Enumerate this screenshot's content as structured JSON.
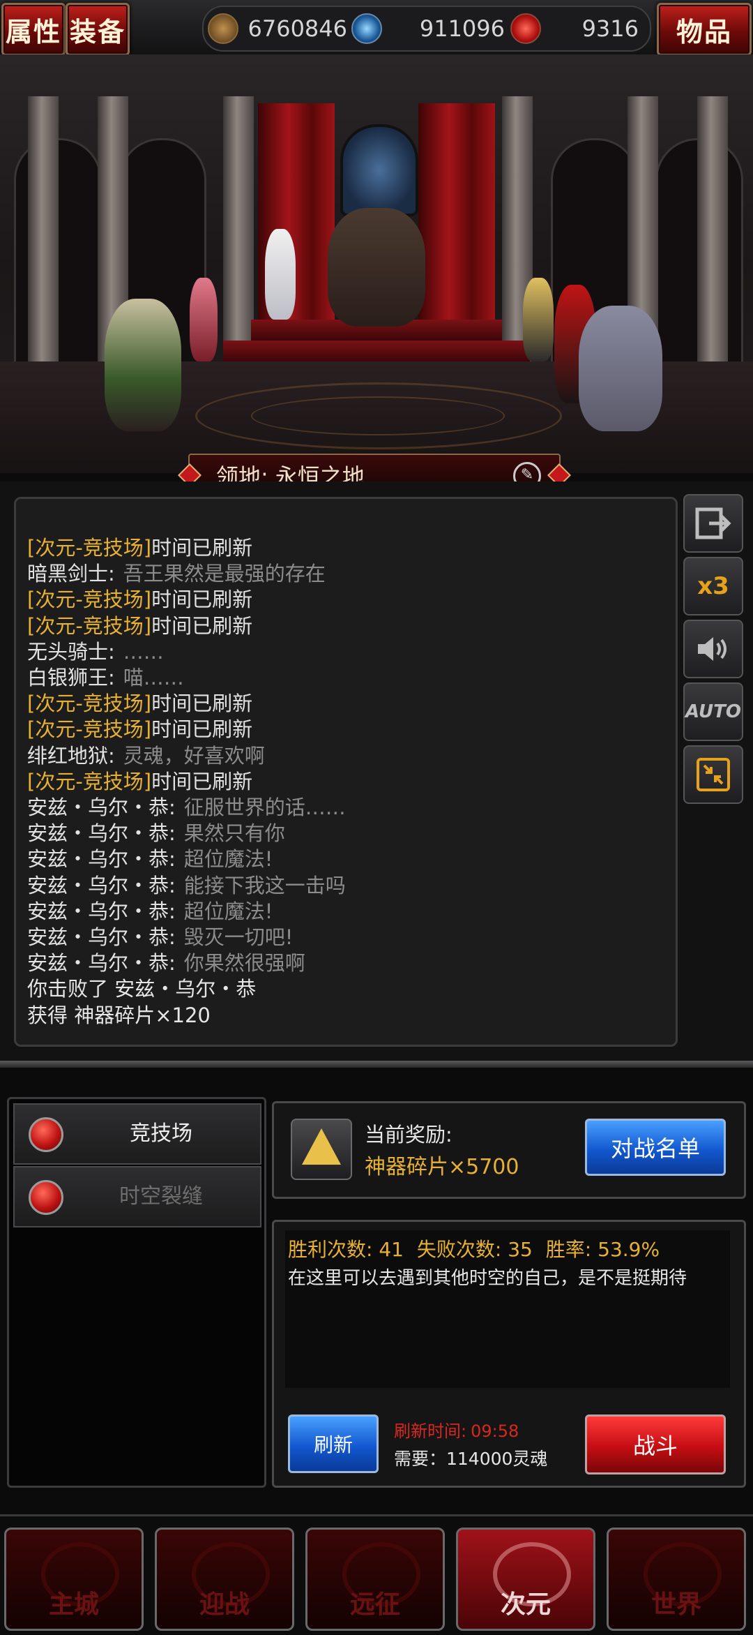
{
  "topbar": {
    "attributes_label": "属性",
    "equipment_label": "装备",
    "items_label": "物品",
    "resources": [
      {
        "icon": "gold-coin-icon",
        "value": "6760846"
      },
      {
        "icon": "blue-orb-icon",
        "value": "911096"
      },
      {
        "icon": "red-soul-icon",
        "value": "9316"
      }
    ]
  },
  "scene": {
    "territory_label": "领地:",
    "territory_name": "永恒之地"
  },
  "log": {
    "lines": [
      {
        "tag": "[次元-竞技场]",
        "text": "时间已刷新"
      },
      {
        "name": "暗黑剑士:",
        "text": "吾王果然是最强的存在"
      },
      {
        "tag": "[次元-竞技场]",
        "text": "时间已刷新"
      },
      {
        "tag": "[次元-竞技场]",
        "text": "时间已刷新"
      },
      {
        "name": "无头骑士:",
        "text": "……"
      },
      {
        "name": "白银狮王:",
        "text": "喵……"
      },
      {
        "tag": "[次元-竞技场]",
        "text": "时间已刷新"
      },
      {
        "tag": "[次元-竞技场]",
        "text": "时间已刷新"
      },
      {
        "name": "绯红地狱:",
        "text": "灵魂，好喜欢啊"
      },
      {
        "tag": "[次元-竞技场]",
        "text": "时间已刷新"
      },
      {
        "name": "安兹・乌尔・恭:",
        "text": "征服世界的话……"
      },
      {
        "name": "安兹・乌尔・恭:",
        "text": "果然只有你"
      },
      {
        "name": "安兹・乌尔・恭:",
        "text": "超位魔法!"
      },
      {
        "name": "安兹・乌尔・恭:",
        "text": "能接下我这一击吗"
      },
      {
        "name": "安兹・乌尔・恭:",
        "text": "超位魔法!"
      },
      {
        "name": "安兹・乌尔・恭:",
        "text": "毁灭一切吧!"
      },
      {
        "name": "安兹・乌尔・恭:",
        "text": "你果然很强啊"
      }
    ],
    "defeat_line": "你击败了 安兹・乌尔・恭",
    "reward_line": "获得 神器碎片×120"
  },
  "side_buttons": {
    "speed_label": "x3"
  },
  "modes": [
    {
      "label": "竞技场",
      "active": true
    },
    {
      "label": "时空裂缝",
      "active": false
    }
  ],
  "reward": {
    "title": "当前奖励:",
    "value": "神器碎片×5700",
    "button": "对战名单"
  },
  "stats": {
    "wins_label": "胜利次数:",
    "wins": "41",
    "losses_label": "失败次数:",
    "losses": "35",
    "rate_label": "胜率:",
    "rate": "53.9%",
    "description": "在这里可以去遇到其他时空的自己，是不是挺期待",
    "refresh_button": "刷新",
    "refresh_time_label": "刷新时间:",
    "refresh_time": "09:58",
    "cost": "需要：114000灵魂",
    "battle_button": "战斗"
  },
  "nav": [
    {
      "label": "主城",
      "icon": "castle-icon",
      "active": false
    },
    {
      "label": "迎战",
      "icon": "crossed-swords-icon",
      "active": false
    },
    {
      "label": "远征",
      "icon": "flag-icon",
      "active": false
    },
    {
      "label": "次元",
      "icon": "dimension-icon",
      "active": true
    },
    {
      "label": "世界",
      "icon": "globe-icon",
      "active": false
    }
  ],
  "colors": {
    "accent_gold": "#e7b132",
    "accent_red": "#c01414",
    "accent_blue": "#1258d0"
  }
}
